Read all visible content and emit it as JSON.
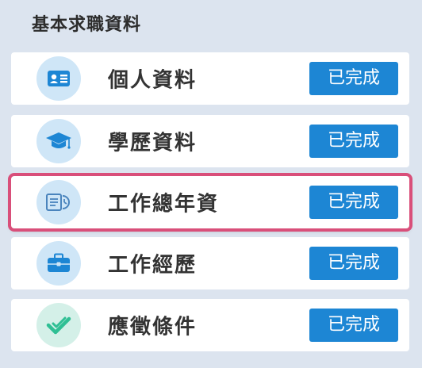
{
  "panel": {
    "title": "基本求職資料"
  },
  "items": [
    {
      "label": "個人資料",
      "status": "已完成",
      "icon": "id-card-icon"
    },
    {
      "label": "學歷資料",
      "status": "已完成",
      "icon": "graduation-cap-icon"
    },
    {
      "label": "工作總年資",
      "status": "已完成",
      "icon": "document-clock-icon"
    },
    {
      "label": "工作經歷",
      "status": "已完成",
      "icon": "briefcase-icon"
    },
    {
      "label": "應徵條件",
      "status": "已完成",
      "icon": "double-check-icon"
    }
  ],
  "colors": {
    "accent": "#1d86d4",
    "icon_bg": "#cfe6f7",
    "icon_bg_green": "#d4f0e8",
    "icon_green": "#2fbf94",
    "selection_highlight": "#d94f7a",
    "panel_bg": "#dce4ef"
  }
}
